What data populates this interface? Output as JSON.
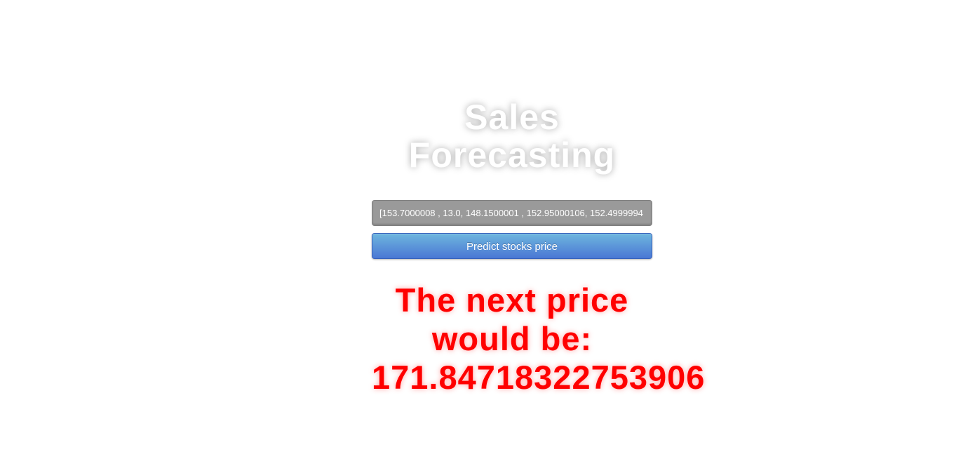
{
  "header": {
    "title_line1": "Sales",
    "title_line2": "Forecasting"
  },
  "form": {
    "input_value": "[153.7000008 , 13.0, 148.1500001 , 152.95000106, 152.4999994",
    "submit_label": "Predict stocks price"
  },
  "result": {
    "line1": "The next price",
    "line2": "would be:",
    "value": "171.84718322753906"
  },
  "colors": {
    "result_text": "#ff0000",
    "button_top": "#6eb6de",
    "button_bottom": "#4a77d4",
    "input_bg": "#9a9a9a"
  }
}
